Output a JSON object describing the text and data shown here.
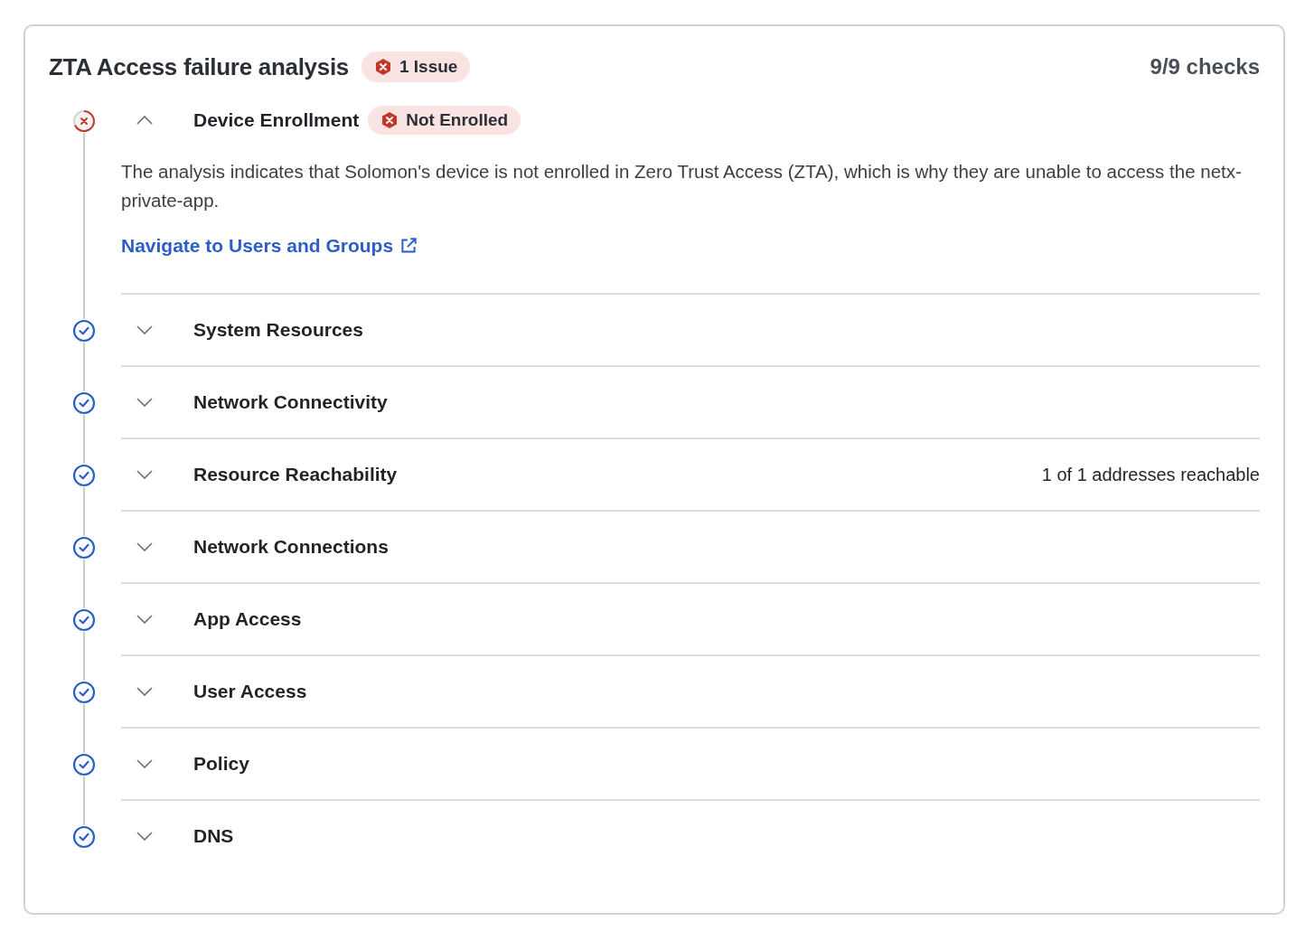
{
  "title": "ZTA Access failure analysis",
  "issue_badge": "1 Issue",
  "checks": "9/9 checks",
  "steps": [
    {
      "title": "Device Enrollment",
      "kind": "fail",
      "expanded": true,
      "badge": "Not Enrolled",
      "description": "The analysis indicates that Solomon's device is not enrolled in Zero Trust Access (ZTA), which is why they are unable to access the netx-private-app.",
      "link": "Navigate to Users and Groups"
    },
    {
      "title": "System Resources",
      "kind": "pass",
      "expanded": false
    },
    {
      "title": "Network Connectivity",
      "kind": "pass",
      "expanded": false
    },
    {
      "title": "Resource Reachability",
      "kind": "pass",
      "expanded": false,
      "summary": "1 of 1 addresses reachable"
    },
    {
      "title": "Network Connections",
      "kind": "pass",
      "expanded": false
    },
    {
      "title": "App Access",
      "kind": "pass",
      "expanded": false
    },
    {
      "title": "User Access",
      "kind": "pass",
      "expanded": false
    },
    {
      "title": "Policy",
      "kind": "pass",
      "expanded": false
    },
    {
      "title": "DNS",
      "kind": "pass",
      "expanded": false
    }
  ]
}
